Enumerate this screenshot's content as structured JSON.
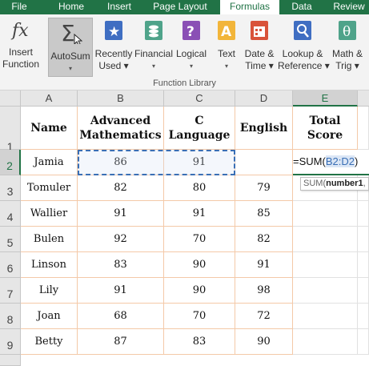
{
  "ribbon": {
    "tabs": [
      {
        "label": "File",
        "active": false
      },
      {
        "label": "Home",
        "active": false
      },
      {
        "label": "Insert",
        "active": false
      },
      {
        "label": "Page Layout",
        "active": false
      },
      {
        "label": "Formulas",
        "active": true
      },
      {
        "label": "Data",
        "active": false
      },
      {
        "label": "Review",
        "active": false
      }
    ],
    "buttons": [
      {
        "line1": "Insert",
        "line2": "Function",
        "icon": "insert-function-icon"
      },
      {
        "line1": "AutoSum",
        "line2": "▾",
        "icon": "autosum-icon"
      },
      {
        "line1": "Recently",
        "line2": "Used ▾",
        "icon": "recently-used-icon"
      },
      {
        "line1": "Financial",
        "line2": "▾",
        "icon": "financial-icon"
      },
      {
        "line1": "Logical",
        "line2": "▾",
        "icon": "logical-icon"
      },
      {
        "line1": "Text",
        "line2": "▾",
        "icon": "text-icon"
      },
      {
        "line1": "Date &",
        "line2": "Time ▾",
        "icon": "date-time-icon"
      },
      {
        "line1": "Lookup &",
        "line2": "Reference ▾",
        "icon": "lookup-reference-icon"
      },
      {
        "line1": "Math &",
        "line2": "Trig ▾",
        "icon": "math-trig-icon"
      }
    ],
    "group_label": "Function Library",
    "colors": {
      "brand": "#217346",
      "accent_border": "#f4c9a8",
      "range_blue": "#3a6fb5"
    }
  },
  "grid": {
    "columns": [
      "A",
      "B",
      "C",
      "D",
      "E"
    ],
    "selected_column": "E",
    "rows": [
      "1",
      "2",
      "3",
      "4",
      "5",
      "6",
      "7",
      "8",
      "9"
    ],
    "selected_row": "2",
    "header": {
      "name": "Name",
      "adv_math_1": "Advanced",
      "adv_math_2": "Mathematics",
      "clang_1": "C",
      "clang_2": "Language",
      "english": "English",
      "total_1": "Total",
      "total_2": "Score"
    },
    "data": [
      {
        "name": "Jamia",
        "math": "86",
        "c": "91",
        "english": ""
      },
      {
        "name": "Tomuler",
        "math": "82",
        "c": "80",
        "english": "79"
      },
      {
        "name": "Wallier",
        "math": "91",
        "c": "91",
        "english": "85"
      },
      {
        "name": "Bulen",
        "math": "92",
        "c": "70",
        "english": "82"
      },
      {
        "name": "Linson",
        "math": "83",
        "c": "90",
        "english": "91"
      },
      {
        "name": "Lily",
        "math": "91",
        "c": "90",
        "english": "98"
      },
      {
        "name": "Joan",
        "math": "68",
        "c": "70",
        "english": "72"
      },
      {
        "name": "Betty",
        "math": "87",
        "c": "83",
        "english": "90"
      }
    ],
    "formula": {
      "prefix": "=SUM(",
      "range": "B2:D2",
      "suffix": ")"
    },
    "tooltip": {
      "prefix": "SUM(",
      "arg": "number1",
      "suffix": ","
    }
  }
}
